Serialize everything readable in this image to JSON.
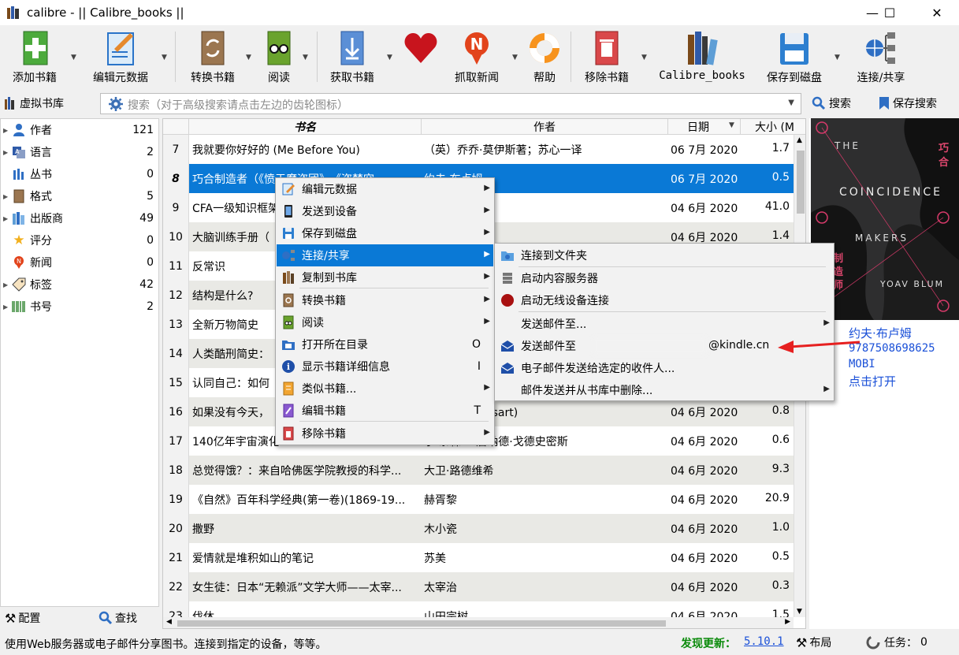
{
  "window": {
    "title": "calibre - || Calibre_books ||",
    "controls": {
      "minimize": "—",
      "maximize": "☐",
      "close": "✕"
    }
  },
  "toolbar": {
    "add_books": "添加书籍",
    "edit_metadata": "编辑元数据",
    "convert_books": "转换书籍",
    "view": "阅读",
    "get_books": "获取书籍",
    "fetch_news": "抓取新闻",
    "help": "帮助",
    "remove_books": "移除书籍",
    "library": "Calibre_books",
    "save_to_disk": "保存到磁盘",
    "connect_share": "连接/共享"
  },
  "searchbar": {
    "virtual_library": "虚拟书库",
    "placeholder": "搜索（对于高级搜索请点击左边的齿轮图标）",
    "search_button": "搜索",
    "saved_searches": "保存搜索"
  },
  "tag_browser": {
    "items": [
      {
        "name": "作者",
        "count": "121",
        "icon": "person-icon",
        "expand": true
      },
      {
        "name": "语言",
        "count": "2",
        "icon": "language-icon",
        "expand": true
      },
      {
        "name": "丛书",
        "count": "0",
        "icon": "series-icon",
        "expand": false
      },
      {
        "name": "格式",
        "count": "5",
        "icon": "format-icon",
        "expand": true
      },
      {
        "name": "出版商",
        "count": "49",
        "icon": "publisher-icon",
        "expand": true
      },
      {
        "name": "评分",
        "count": "0",
        "icon": "star-icon",
        "expand": false
      },
      {
        "name": "新闻",
        "count": "0",
        "icon": "news-icon",
        "expand": false
      },
      {
        "name": "标签",
        "count": "42",
        "icon": "tag-icon",
        "expand": true
      },
      {
        "name": "书号",
        "count": "2",
        "icon": "barcode-icon",
        "expand": true
      }
    ],
    "configure": "配置",
    "find": "查找"
  },
  "book_list": {
    "columns": {
      "title": "书名",
      "author": "作者",
      "date": "日期",
      "size": "大小 (M"
    },
    "rows": [
      {
        "num": "7",
        "title": "我就要你好好的 (Me Before You)",
        "author": "（英）乔乔·莫伊斯著；苏心一译",
        "date": "06 7月 2020",
        "size": "1.7"
      },
      {
        "num": "8",
        "title": "巧合制造者（《愤于魔盗团》、《盗梦空",
        "author": "约夫·布卢姆",
        "date": "06 7月 2020",
        "size": "0.5"
      },
      {
        "num": "9",
        "title": "CFA一级知识框架",
        "author": "",
        "date": "04 6月 2020",
        "size": "41.0"
      },
      {
        "num": "10",
        "title": "大脑训练手册（",
        "author": "",
        "date": "04 6月 2020",
        "size": "1.4"
      },
      {
        "num": "11",
        "title": "反常识",
        "author": "",
        "date": "",
        "size": ""
      },
      {
        "num": "12",
        "title": "结构是什么?",
        "author": "",
        "date": "",
        "size": ""
      },
      {
        "num": "13",
        "title": "全新万物简史",
        "author": "",
        "date": "",
        "size": ""
      },
      {
        "num": "14",
        "title": "人类酷刑简史：",
        "author": "",
        "date": "",
        "size": ""
      },
      {
        "num": "15",
        "title": "认同自己：如何",
        "author": "",
        "date": "",
        "size": ""
      },
      {
        "num": "16",
        "title": "如果没有今天，",
        "author": "寺 (Yves Bossart)",
        "date": "04 6月 2020",
        "size": "0.8"
      },
      {
        "num": "17",
        "title": "140亿年宇宙演化",
        "author": "尔·泰森 & 唐纳德·戈德史密斯",
        "date": "04 6月 2020",
        "size": "0.6"
      },
      {
        "num": "18",
        "title": "总觉得饿？：来自哈佛医学院教授的科学...",
        "author": "大卫·路德维希",
        "date": "04 6月 2020",
        "size": "9.3"
      },
      {
        "num": "19",
        "title": "《自然》百年科学经典(第一卷)(1869-19...",
        "author": "赫胥黎",
        "date": "04 6月 2020",
        "size": "20.9"
      },
      {
        "num": "20",
        "title": "撒野",
        "author": "木小瓷",
        "date": "04 6月 2020",
        "size": "1.0"
      },
      {
        "num": "21",
        "title": "爱情就是堆积如山的笔记",
        "author": "苏美",
        "date": "04 6月 2020",
        "size": "0.5"
      },
      {
        "num": "22",
        "title": "女生徒：日本“无赖派”文学大师——太宰...",
        "author": "太宰治",
        "date": "04 6月 2020",
        "size": "0.3"
      },
      {
        "num": "23",
        "title": "伐休",
        "author": "山田宗树",
        "date": "04 6月 2020",
        "size": "1.5"
      }
    ]
  },
  "context_menu": {
    "items": [
      {
        "label": "编辑元数据",
        "icon": "edit-metadata-icon",
        "shortcut": "",
        "submenu": true
      },
      {
        "label": "发送到设备",
        "icon": "device-icon",
        "shortcut": "",
        "submenu": true
      },
      {
        "label": "保存到磁盘",
        "icon": "floppy-icon",
        "shortcut": "",
        "submenu": true
      },
      {
        "label": "连接/共享",
        "icon": "connect-share-icon",
        "shortcut": "",
        "submenu": true,
        "highlighted": true
      },
      {
        "label": "复制到书库",
        "icon": "copy-library-icon",
        "shortcut": "",
        "submenu": true
      },
      {
        "label": "转换书籍",
        "icon": "convert-icon",
        "shortcut": "",
        "submenu": true
      },
      {
        "label": "阅读",
        "icon": "reader-icon",
        "shortcut": "",
        "submenu": true
      },
      {
        "label": "打开所在目录",
        "icon": "folder-icon",
        "shortcut": "O",
        "submenu": false
      },
      {
        "label": "显示书籍详细信息",
        "icon": "info-icon",
        "shortcut": "I",
        "submenu": false
      },
      {
        "label": "类似书籍...",
        "icon": "similar-books-icon",
        "shortcut": "",
        "submenu": true
      },
      {
        "label": "编辑书籍",
        "icon": "edit-book-icon",
        "shortcut": "T",
        "submenu": false
      },
      {
        "label": "移除书籍",
        "icon": "trash-icon",
        "shortcut": "",
        "submenu": true
      }
    ]
  },
  "submenu": {
    "items": [
      {
        "label": "连接到文件夹",
        "icon": "folder-connect-icon",
        "submenu": false
      },
      {
        "label": "启动内容服务器",
        "icon": "server-icon",
        "submenu": false
      },
      {
        "label": "启动无线设备连接",
        "icon": "wireless-icon",
        "submenu": false
      },
      {
        "label": "发送邮件至...",
        "icon": "",
        "submenu": true
      },
      {
        "label": "发送邮件至",
        "icon": "mail-icon",
        "submenu": false,
        "suffix": "@kindle.cn"
      },
      {
        "label": "电子邮件发送给选定的收件人...",
        "icon": "mail-icon",
        "submenu": false
      },
      {
        "label": "邮件发送并从书库中删除...",
        "icon": "",
        "submenu": true
      }
    ]
  },
  "details": {
    "author": "约夫·布卢姆",
    "isbn": "9787508698625",
    "format": "MOBI",
    "path": "点击打开",
    "cover_title_lines": [
      "THE",
      "COINCIDENCE",
      "MAKERS",
      "YOAV BLUM"
    ],
    "cover_cn": [
      "巧",
      "合"
    ],
    "cover_cn2": [
      "制",
      "造",
      "师"
    ]
  },
  "statusbar": {
    "message": "使用Web服务器或电子邮件分享图书。连接到指定的设备，等等。",
    "update_label": "发现更新：",
    "update_version": "5.10.1",
    "layout": "布局",
    "tasks": "任务：",
    "tasks_count": "0"
  },
  "colors": {
    "selection": "#0a79d6",
    "update_green": "#0a8a0a",
    "link_blue": "#1a50d8"
  }
}
